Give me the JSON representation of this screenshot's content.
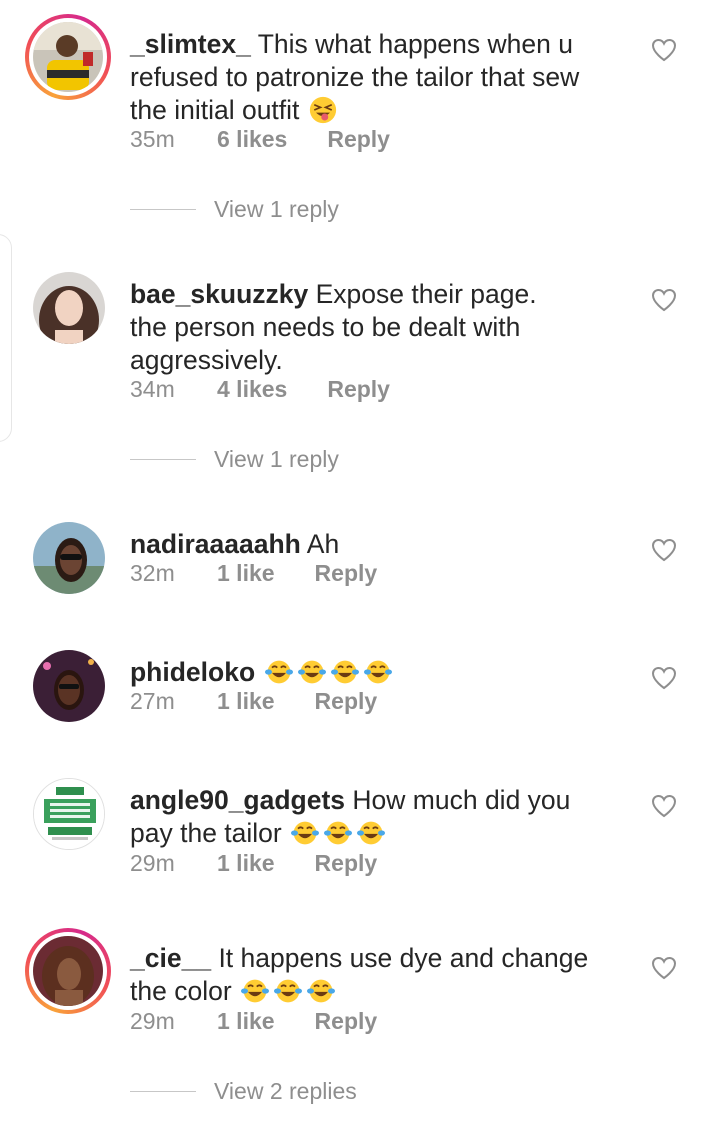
{
  "comments": [
    {
      "username": "_slimtex_",
      "text": "This what happens when u refused to patronize the tailor that sew the initial outfit",
      "emoji_icons": [
        "squinting-tongue-emoji"
      ],
      "time": "35m",
      "likes": "6 likes",
      "reply_label": "Reply",
      "view_replies": "View 1 reply",
      "has_story_ring": true
    },
    {
      "username": "bae_skuuzzky",
      "text": "Expose their page.\nthe person needs to be dealt with aggressively.",
      "emoji_icons": [],
      "time": "34m",
      "likes": "4 likes",
      "reply_label": "Reply",
      "view_replies": "View 1 reply",
      "has_story_ring": false
    },
    {
      "username": "nadiraaaaahh",
      "text": "Ah",
      "emoji_icons": [],
      "time": "32m",
      "likes": "1 like",
      "reply_label": "Reply",
      "has_story_ring": false
    },
    {
      "username": "phideloko",
      "text": "",
      "emoji_icons": [
        "laughing-tears-emoji",
        "laughing-tears-emoji",
        "laughing-tears-emoji",
        "laughing-tears-emoji"
      ],
      "time": "27m",
      "likes": "1 like",
      "reply_label": "Reply",
      "has_story_ring": false
    },
    {
      "username": "angle90_gadgets",
      "text": "How much did you pay the tailor",
      "emoji_icons": [
        "laughing-tears-emoji",
        "laughing-tears-emoji",
        "laughing-tears-emoji"
      ],
      "time": "29m",
      "likes": "1 like",
      "reply_label": "Reply",
      "has_story_ring": false
    },
    {
      "username": "_cie__",
      "text": "It happens use dye and change the color",
      "emoji_icons": [
        "laughing-tears-emoji",
        "laughing-tears-emoji",
        "laughing-tears-emoji"
      ],
      "time": "29m",
      "likes": "1 like",
      "reply_label": "Reply",
      "view_replies": "View 2 replies",
      "has_story_ring": true
    }
  ],
  "colors": {
    "text": "#262626",
    "secondary": "#8e8e8e",
    "ring_start": "#f9a23a",
    "ring_end": "#d62a8b"
  }
}
